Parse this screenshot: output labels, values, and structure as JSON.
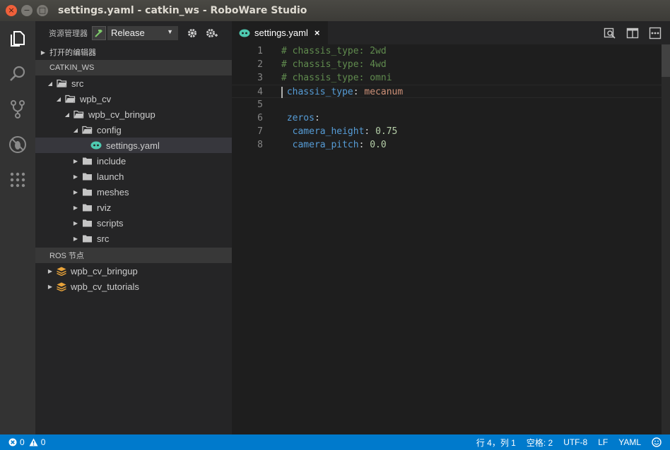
{
  "window": {
    "title": "settings.yaml - catkin_ws - RoboWare Studio",
    "buttons": {
      "close": "×",
      "minimize": "−",
      "maximize": "□"
    }
  },
  "activity_bar": {
    "items": [
      {
        "name": "explorer",
        "icon": "files-icon"
      },
      {
        "name": "search",
        "icon": "search-icon"
      },
      {
        "name": "git",
        "icon": "source-control-icon"
      },
      {
        "name": "debug",
        "icon": "debug-icon"
      },
      {
        "name": "extensions",
        "icon": "extensions-icon"
      }
    ]
  },
  "sidebar": {
    "title": "资源管理器",
    "build_config": "Release",
    "sections": {
      "open_editors": "打开的编辑器",
      "workspace": "CATKIN_WS",
      "ros_nodes": "ROS 节点"
    },
    "tree": [
      {
        "label": "src",
        "depth": 1,
        "type": "folder",
        "expanded": true
      },
      {
        "label": "wpb_cv",
        "depth": 2,
        "type": "folder",
        "expanded": true
      },
      {
        "label": "wpb_cv_bringup",
        "depth": 3,
        "type": "folder",
        "expanded": true
      },
      {
        "label": "config",
        "depth": 4,
        "type": "folder",
        "expanded": true
      },
      {
        "label": "settings.yaml",
        "depth": 5,
        "type": "yaml",
        "selected": true
      },
      {
        "label": "include",
        "depth": 4,
        "type": "folder",
        "expanded": false
      },
      {
        "label": "launch",
        "depth": 4,
        "type": "folder",
        "expanded": false
      },
      {
        "label": "meshes",
        "depth": 4,
        "type": "folder",
        "expanded": false
      },
      {
        "label": "rviz",
        "depth": 4,
        "type": "folder",
        "expanded": false
      },
      {
        "label": "scripts",
        "depth": 4,
        "type": "folder",
        "expanded": false
      },
      {
        "label": "src",
        "depth": 4,
        "type": "folder",
        "expanded": false
      }
    ],
    "ros_nodes": [
      {
        "label": "wpb_cv_bringup"
      },
      {
        "label": "wpb_cv_tutorials"
      }
    ]
  },
  "tab": {
    "label": "settings.yaml",
    "close": "×"
  },
  "editor": {
    "lines": [
      {
        "n": "1",
        "parts": [
          {
            "t": "cmt",
            "v": "# chassis_type: 2wd"
          }
        ]
      },
      {
        "n": "2",
        "parts": [
          {
            "t": "cmt",
            "v": "# chassis_type: 4wd"
          }
        ]
      },
      {
        "n": "3",
        "parts": [
          {
            "t": "cmt",
            "v": "# chassis_type: omni"
          }
        ]
      },
      {
        "n": "4",
        "parts": [
          {
            "t": "key",
            "v": " chassis_type"
          },
          {
            "t": "punc",
            "v": ": "
          },
          {
            "t": "str",
            "v": "mecanum"
          }
        ]
      },
      {
        "n": "5",
        "parts": []
      },
      {
        "n": "6",
        "parts": [
          {
            "t": "key",
            "v": " zeros"
          },
          {
            "t": "punc",
            "v": ":"
          }
        ]
      },
      {
        "n": "7",
        "parts": [
          {
            "t": "key",
            "v": "  camera_height"
          },
          {
            "t": "punc",
            "v": ": "
          },
          {
            "t": "num",
            "v": "0.75"
          }
        ]
      },
      {
        "n": "8",
        "parts": [
          {
            "t": "key",
            "v": "  camera_pitch"
          },
          {
            "t": "punc",
            "v": ": "
          },
          {
            "t": "num",
            "v": "0.0"
          }
        ]
      }
    ],
    "current_line": "4"
  },
  "status": {
    "errors": "0",
    "warnings": "0",
    "position": "行 4，列 1",
    "indent": "空格: 2",
    "encoding": "UTF-8",
    "eol": "LF",
    "language": "YAML"
  },
  "colors": {
    "accent": "#007acc",
    "yaml_icon": "#4ec9b0",
    "nodes_icon": "#e8a33a"
  }
}
